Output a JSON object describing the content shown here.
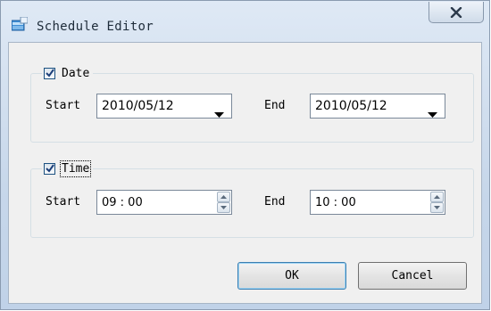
{
  "window": {
    "title": "Schedule Editor",
    "close_label": "X"
  },
  "date_group": {
    "label": "Date",
    "checked": true,
    "start_label": "Start",
    "start_value": "2010/05/12",
    "end_label": "End",
    "end_value": "2010/05/12"
  },
  "time_group": {
    "label": "Time",
    "checked": true,
    "start_label": "Start",
    "start_value": "09 : 00",
    "end_label": "End",
    "end_value": "10 : 00"
  },
  "buttons": {
    "ok": "OK",
    "cancel": "Cancel"
  },
  "icons": [
    "app-icon",
    "close-icon",
    "checkmark-icon",
    "dropdown-arrow-icon",
    "spin-up-icon",
    "spin-down-icon"
  ],
  "colors": {
    "title_bar": "#c7d7ea",
    "client_bg": "#f0f0f0",
    "checkmark": "#1c3f7a",
    "default_button_border": "#3c7fb1"
  }
}
